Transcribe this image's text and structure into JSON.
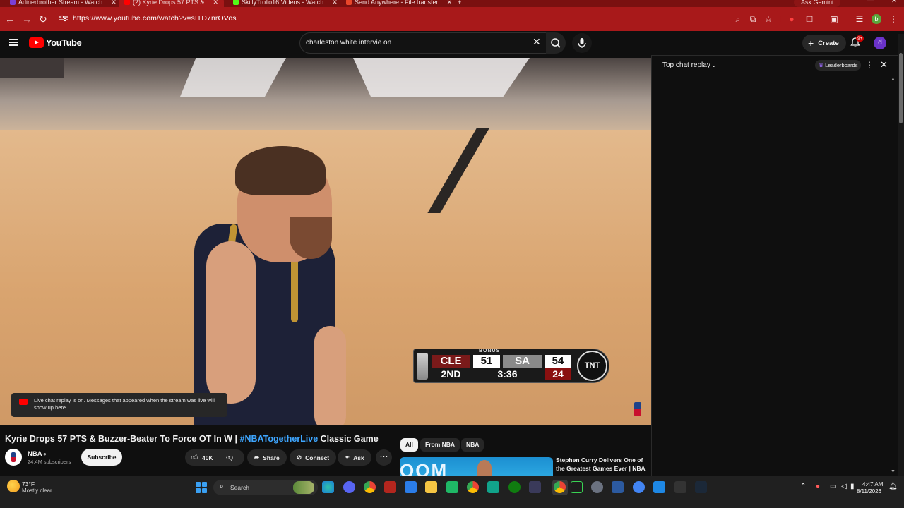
{
  "browser": {
    "tabs": [
      {
        "label": "Adinerbrother Stream - Watch",
        "color": "#7b3fd4"
      },
      {
        "label": "(2) Kyrie Drops 57 PTS &",
        "color": "#ff0000"
      },
      {
        "label": "SkillyTrollo16 Videos - Watch",
        "color": "#53fc18"
      },
      {
        "label": "Send Anywhere - File transfer",
        "color": "#e8462a"
      }
    ],
    "gemini_label": "Ask Gemini",
    "url": "https://www.youtube.com/watch?v=sITD7nrOVos",
    "profile_letter": "b",
    "accent": "#a8191a"
  },
  "youtube": {
    "logo_text": "YouTube",
    "search_value": "charleston white intervie on",
    "create_label": "Create",
    "notification_badge": "9+",
    "avatar_letter": "d"
  },
  "video": {
    "scorebug": {
      "bonus": "BONUS",
      "home_abbr": "CLE",
      "home_score": "51",
      "away_abbr": "SA",
      "away_score": "54",
      "period": "2ND",
      "clock": "3:36",
      "shot_clock": "24",
      "network": "TNT"
    },
    "title_main": "Kyrie Drops 57 PTS & Buzzer-Beater To Force OT In W | ",
    "title_tag": "#NBATogetherLive",
    "title_end": " Classic Game",
    "channel": "NBA",
    "subscribers": "24.4M subscribers",
    "subscribe_label": "Subscribe",
    "likes": "40K",
    "share_label": "Share",
    "connect_label": "Connect",
    "ask_label": "Ask"
  },
  "chat": {
    "title": "Top chat replay",
    "leaderboards_label": "Leaderboards",
    "notice": "Live chat replay is on. Messages that appeared when the stream was live will show up here."
  },
  "recommendations": {
    "chips": [
      "All",
      "From NBA",
      "NBA"
    ],
    "first_title": "Stephen Curry Delivers One of the Greatest Games Ever | NBA",
    "first_thumb_text": "OOM"
  },
  "taskbar": {
    "weather_temp": "73°F",
    "weather_desc": "Mostly clear",
    "search_label": "Search",
    "time": "4:47 AM",
    "date": "8/11/2026"
  }
}
